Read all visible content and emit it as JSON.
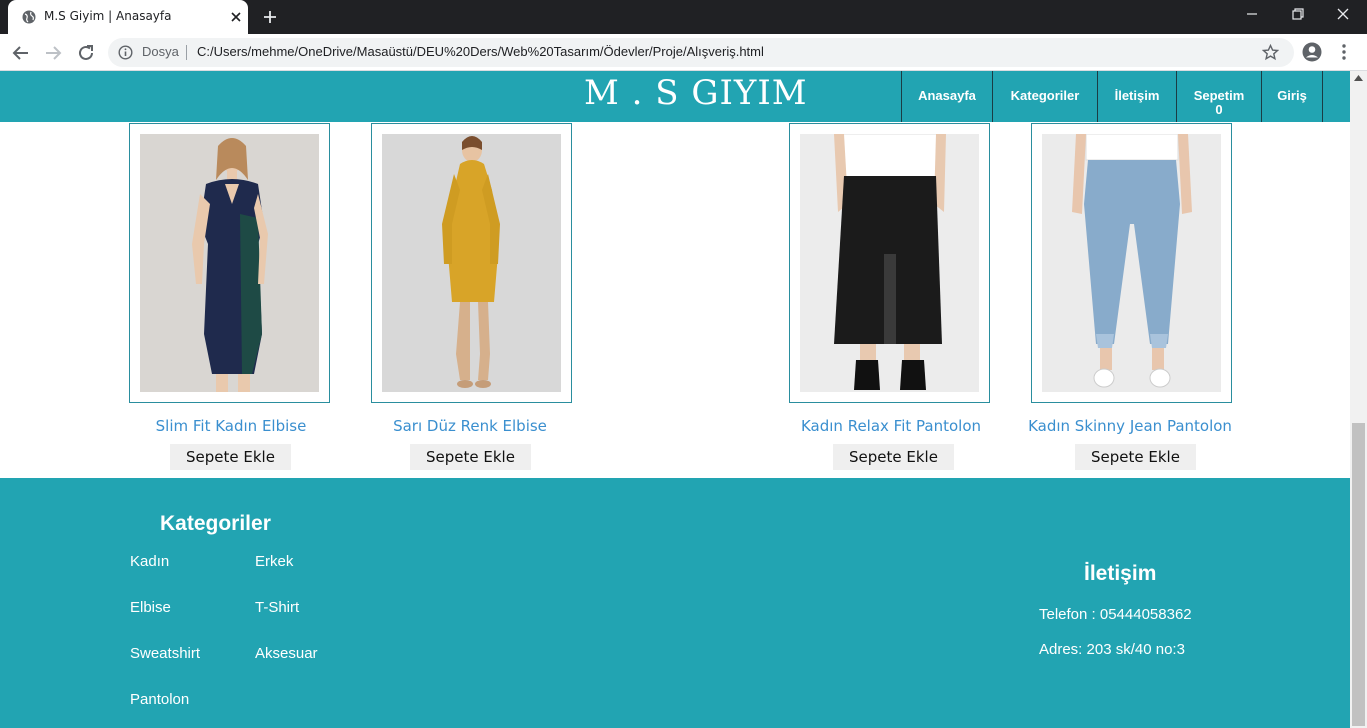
{
  "browser": {
    "tab_title": "M.S Giyim | Anasayfa",
    "security_label": "Dosya",
    "url": "C:/Users/mehme/OneDrive/Masaüstü/DEU%20Ders/Web%20Tasarım/Ödevler/Proje/Alışveriş.html"
  },
  "site": {
    "logo": "M . S GIYIM",
    "nav": {
      "home": "Anasayfa",
      "categories": "Kategoriler",
      "contact": "İletişim",
      "cart": "Sepetim",
      "cart_count": "0",
      "login": "Giriş"
    }
  },
  "products": [
    {
      "name": "Slim Fit Kadın Elbise",
      "button": "Sepete Ekle",
      "image": "navy-green-dress"
    },
    {
      "name": "Sarı Düz Renk Elbise",
      "button": "Sepete Ekle",
      "image": "mustard-sweater-dress"
    },
    {
      "name": "Kadın Relax Fit Pantolon",
      "button": "Sepete Ekle",
      "image": "black-wide-pants"
    },
    {
      "name": "Kadın Skinny Jean Pantolon",
      "button": "Sepete Ekle",
      "image": "light-blue-skinny-jeans"
    }
  ],
  "footer": {
    "categories_title": "Kategoriler",
    "categories": [
      "Kadın",
      "Erkek",
      "Elbise",
      "T-Shirt",
      "Sweatshirt",
      "Aksesuar",
      "Pantolon"
    ],
    "contact_title": "İletişim",
    "phone": "Telefon : 05444058362",
    "address": "Adres: 203 sk/40 no:3"
  },
  "colors": {
    "brand_teal": "#22a4b2",
    "link_blue": "#3a8fcf",
    "chrome_dark": "#202124"
  }
}
